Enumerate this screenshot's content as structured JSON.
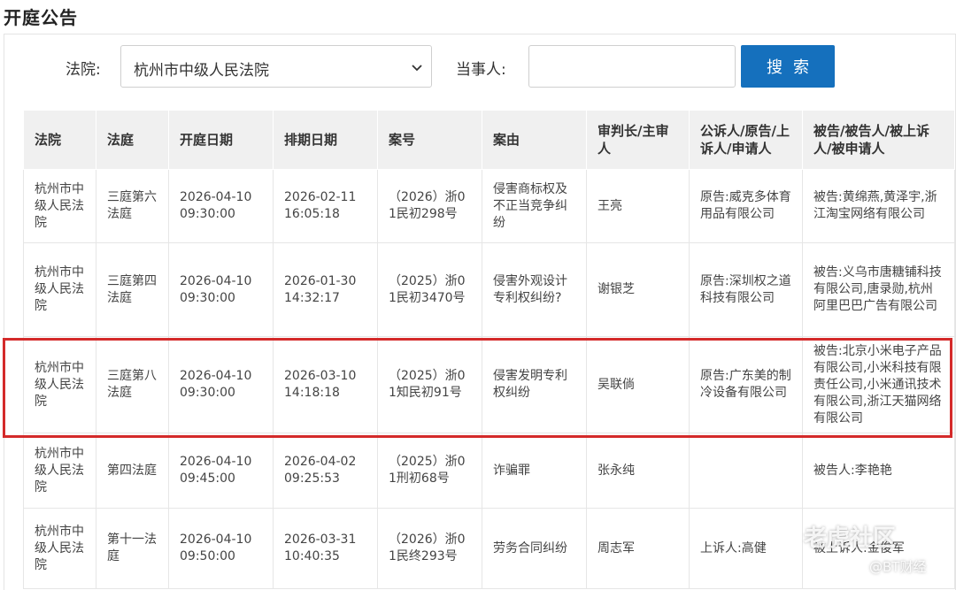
{
  "page": {
    "title": "开庭公告"
  },
  "form": {
    "court_label": "法院:",
    "court_selected": "杭州市中级人民法院",
    "party_label": "当事人:",
    "party_value": "",
    "search_label": "搜索"
  },
  "table": {
    "headers": [
      "法院",
      "法庭",
      "开庭日期",
      "排期日期",
      "案号",
      "案由",
      "审判长/主审人",
      "公诉人/原告/上诉人/申请人",
      "被告/被告人/被上诉人/被申请人"
    ],
    "rows": [
      [
        "杭州市中级人民法院",
        "三庭第六法庭",
        "2026-04-10 09:30:00",
        "2026-02-11 16:05:18",
        "（2026）浙01民初298号",
        "侵害商标权及不正当竞争纠纷",
        "王亮",
        "原告:威克多体育用品有限公司",
        "被告:黄绵燕,黄泽宇,浙江淘宝网络有限公司"
      ],
      [
        "杭州市中级人民法院",
        "三庭第四法庭",
        "2026-04-10 09:30:00",
        "2026-01-30 14:32:17",
        "（2025）浙01民初3470号",
        "侵害外观设计专利权纠纷?",
        "谢银芝",
        "原告:深圳权之道科技有限公司",
        "被告:义乌市唐糖铺科技有限公司,唐录勋,杭州阿里巴巴广告有限公司"
      ],
      [
        "杭州市中级人民法院",
        "三庭第八法庭",
        "2026-04-10 09:30:00",
        "2026-03-10 14:18:18",
        "（2025）浙01知民初91号",
        "侵害发明专利权纠纷",
        "吴联倘",
        "原告:广东美的制冷设备有限公司",
        "被告:北京小米电子产品有限公司,小米科技有限责任公司,小米通讯技术有限公司,浙江天猫网络有限公司"
      ],
      [
        "杭州市中级人民法院",
        "第四法庭",
        "2026-04-10 09:45:00",
        "2026-04-02 09:25:53",
        "（2025）浙01刑初68号",
        "诈骗罪",
        "张永纯",
        "",
        "被告人:李艳艳"
      ],
      [
        "杭州市中级人民法院",
        "第十一法庭",
        "2026-04-10 09:50:00",
        "2026-03-31 10:40:35",
        "（2026）浙01民终293号",
        "劳务合同纠纷",
        "周志军",
        "上诉人:高健",
        "被上诉人:金俊军"
      ]
    ]
  },
  "watermark": {
    "line1": "老虎社区",
    "line2": "@BT财经"
  },
  "colors": {
    "accent": "#1570bd",
    "highlight": "#d42a2a",
    "header_bg": "#f0f0f0"
  }
}
